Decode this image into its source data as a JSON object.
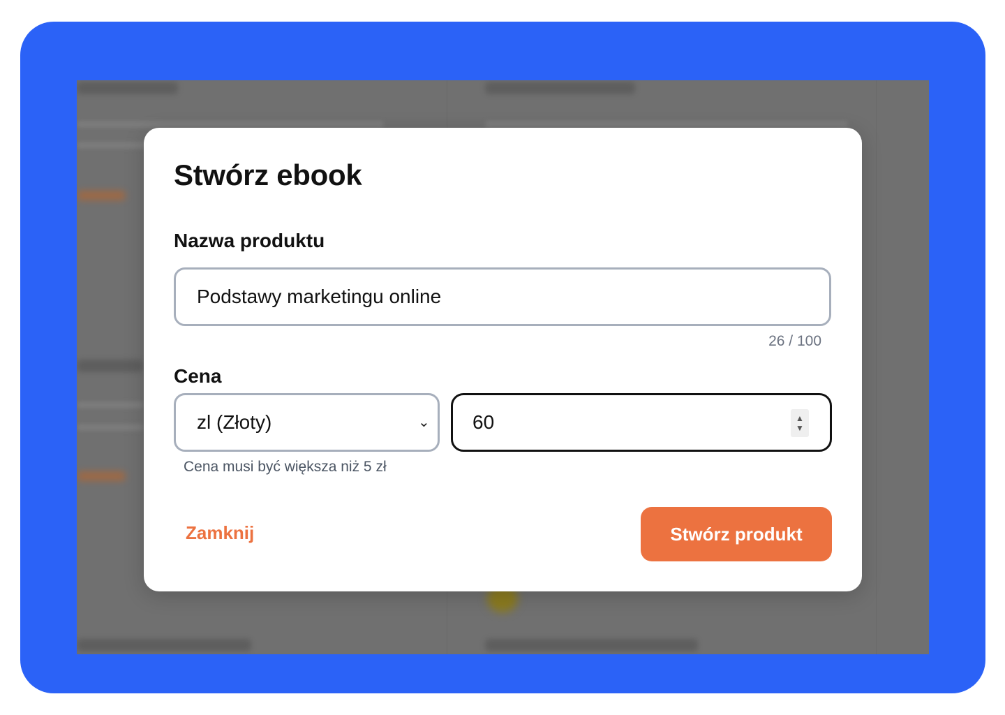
{
  "modal": {
    "title": "Stwórz ebook",
    "name_label": "Nazwa produktu",
    "name_value": "Podstawy marketingu online",
    "name_counter": "26 / 100",
    "price_label": "Cena",
    "currency_value": "zl (Złoty)",
    "price_value": "60",
    "price_hint": "Cena musi być większa niż 5 zł",
    "close_label": "Zamknij",
    "create_label": "Stwórz produkt"
  },
  "colors": {
    "frame": "#2b62f7",
    "accent": "#ec7240",
    "overlay": "#707070"
  },
  "icons": {
    "select_chevron": "chevron-down-icon",
    "price_stepper": "number-stepper-icon"
  }
}
